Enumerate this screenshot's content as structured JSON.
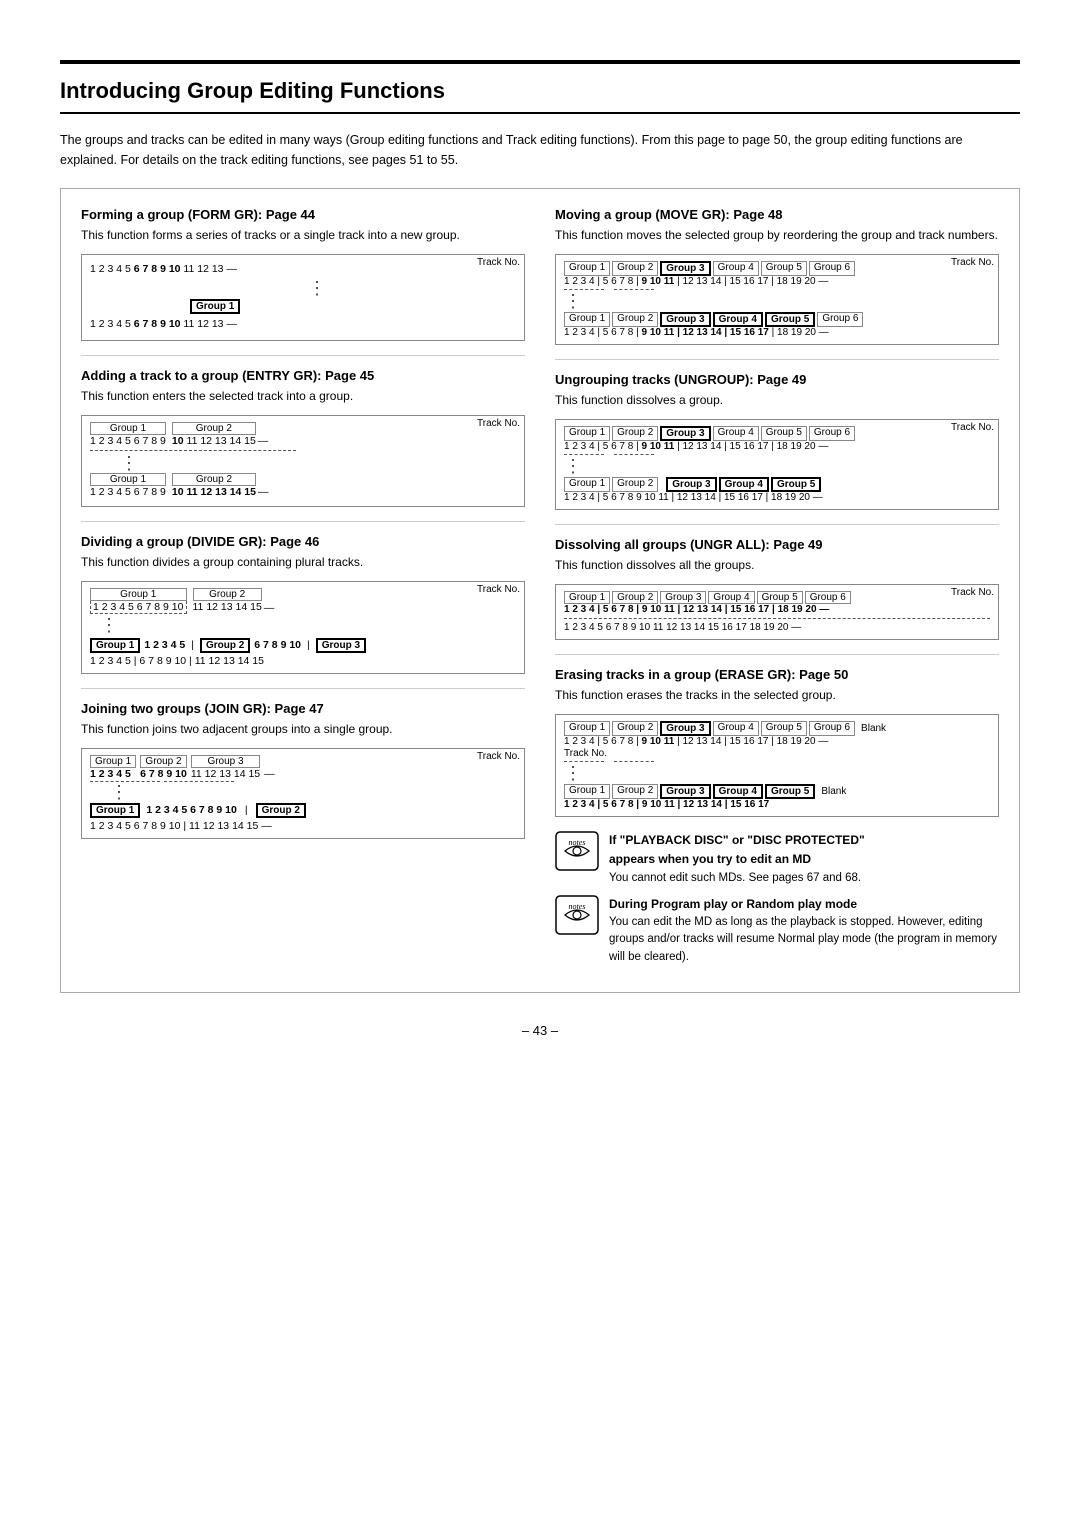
{
  "page": {
    "title": "Introducing Group Editing Functions",
    "intro": "The groups and tracks can be edited in many ways (Group editing functions and Track editing functions). From this page to page 50, the group editing functions are explained. For details on the track editing functions, see pages 51 to 55.",
    "page_number": "– 43 –"
  },
  "sections": {
    "form_gr": {
      "title": "Forming a group (FORM GR): Page 44",
      "desc": "This function forms a series of tracks or a single track into a new group."
    },
    "entry_gr": {
      "title": "Adding a track to a group (ENTRY GR): Page 45",
      "desc": "This function enters the selected track into a group."
    },
    "divide_gr": {
      "title": "Dividing a group (DIVIDE GR): Page 46",
      "desc": "This function divides a group containing plural tracks."
    },
    "join_gr": {
      "title": "Joining two groups (JOIN GR): Page 47",
      "desc": "This function joins two adjacent groups into a single group."
    },
    "move_gr": {
      "title": "Moving a group (MOVE GR): Page 48",
      "desc": "This function moves the selected group by reordering the group and track numbers."
    },
    "ungroup": {
      "title": "Ungrouping tracks (UNGROUP): Page 49",
      "desc": "This function dissolves a group."
    },
    "ungr_all": {
      "title": "Dissolving all groups (UNGR ALL): Page 49",
      "desc": "This function dissolves all the groups."
    },
    "erase_gr": {
      "title": "Erasing tracks in a group (ERASE GR): Page 50",
      "desc": "This function erases the tracks in the selected group."
    }
  },
  "notes": {
    "note1_title": "If \"PLAYBACK DISC\" or \"DISC PROTECTED\"",
    "note1_sub": "appears when you try to edit an MD",
    "note1_body": "You cannot edit such MDs. See pages 67 and 68.",
    "note2_title": "During Program play or Random play mode",
    "note2_body": "You can edit the MD as long as the playback is stopped. However, editing groups and/or tracks will resume Normal play mode (the program in memory will be cleared)."
  }
}
